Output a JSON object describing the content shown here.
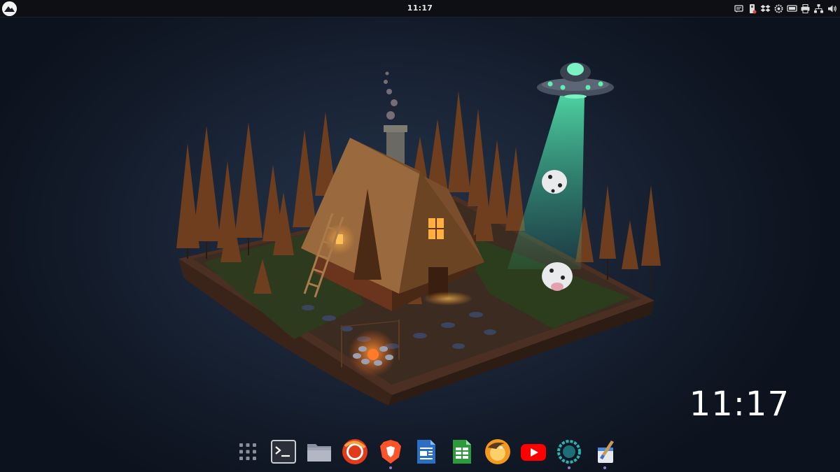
{
  "top_panel": {
    "clock": "11:17",
    "launcher_icon": "zorin-logo-icon",
    "tray_icons": [
      "chat-icon",
      "usb-drive-icon",
      "dropbox-icon",
      "settings-gear-icon",
      "display-icon",
      "printer-icon",
      "network-icon",
      "volume-icon"
    ]
  },
  "desktop_clock": {
    "time": "11:17"
  },
  "dock": {
    "items": [
      {
        "name": "app-grid",
        "icon": "app-grid-icon",
        "running": false
      },
      {
        "name": "terminal",
        "icon": "terminal-icon",
        "running": false
      },
      {
        "name": "files",
        "icon": "folder-icon",
        "running": false
      },
      {
        "name": "browser-red",
        "icon": "red-browser-icon",
        "running": false
      },
      {
        "name": "brave",
        "icon": "brave-lion-icon",
        "running": true
      },
      {
        "name": "writer",
        "icon": "document-writer-icon",
        "running": false
      },
      {
        "name": "calc",
        "icon": "spreadsheet-calc-icon",
        "running": false
      },
      {
        "name": "linux-app",
        "icon": "penguin-app-icon",
        "running": false
      },
      {
        "name": "youtube",
        "icon": "youtube-play-icon",
        "running": false
      },
      {
        "name": "teal-app",
        "icon": "teal-ring-icon",
        "running": true
      },
      {
        "name": "paint",
        "icon": "paint-brush-icon",
        "running": true
      }
    ]
  },
  "colors": {
    "panel": "#0d0f14",
    "background": "#1a2537",
    "accent_dot": "#8f7bd6",
    "ufo_beam": "#3fd6a0"
  }
}
